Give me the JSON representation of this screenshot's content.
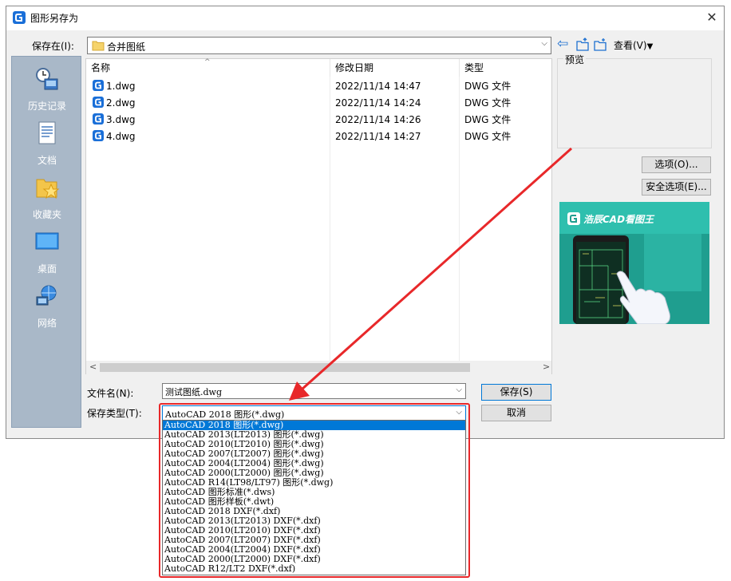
{
  "window": {
    "title": "图形另存为",
    "close_glyph": "✕"
  },
  "toolbar": {
    "save_in_label": "保存在(I):",
    "save_in_value": "合并图纸",
    "view_label": "查看(V)",
    "back_glyph": "⇦",
    "icons": [
      "back-icon",
      "up-folder-icon",
      "new-folder-icon"
    ]
  },
  "places": [
    {
      "label": "历史记录",
      "icon": "history-icon"
    },
    {
      "label": "文档",
      "icon": "documents-icon"
    },
    {
      "label": "收藏夹",
      "icon": "favorites-icon"
    },
    {
      "label": "桌面",
      "icon": "desktop-icon"
    },
    {
      "label": "网络",
      "icon": "network-icon"
    }
  ],
  "file_list": {
    "columns": [
      "名称",
      "修改日期",
      "类型"
    ],
    "rows": [
      {
        "name": "1.dwg",
        "date": "2022/11/14 14:47",
        "type": "DWG 文件"
      },
      {
        "name": "2.dwg",
        "date": "2022/11/14 14:24",
        "type": "DWG 文件"
      },
      {
        "name": "3.dwg",
        "date": "2022/11/14 14:26",
        "type": "DWG 文件"
      },
      {
        "name": "4.dwg",
        "date": "2022/11/14 14:27",
        "type": "DWG 文件"
      }
    ]
  },
  "preview": {
    "label": "预览"
  },
  "buttons": {
    "options": "选项(O)...",
    "security": "安全选项(E)...",
    "save": "保存(S)",
    "cancel": "取消"
  },
  "filename": {
    "label": "文件名(N):",
    "value": "测试图纸.dwg"
  },
  "filetype": {
    "label": "保存类型(T):",
    "value": "AutoCAD 2018 图形(*.dwg)",
    "options": [
      "AutoCAD 2018 图形(*.dwg)",
      "AutoCAD 2013(LT2013) 图形(*.dwg)",
      "AutoCAD 2010(LT2010) 图形(*.dwg)",
      "AutoCAD 2007(LT2007) 图形(*.dwg)",
      "AutoCAD 2004(LT2004) 图形(*.dwg)",
      "AutoCAD 2000(LT2000) 图形(*.dwg)",
      "AutoCAD R14(LT98/LT97) 图形(*.dwg)",
      "AutoCAD 图形标准(*.dws)",
      "AutoCAD 图形样板(*.dwt)",
      "AutoCAD 2018 DXF(*.dxf)",
      "AutoCAD 2013(LT2013) DXF(*.dxf)",
      "AutoCAD 2010(LT2010) DXF(*.dxf)",
      "AutoCAD 2007(LT2007) DXF(*.dxf)",
      "AutoCAD 2004(LT2004) DXF(*.dxf)",
      "AutoCAD 2000(LT2000) DXF(*.dxf)",
      "AutoCAD R12/LT2 DXF(*.dxf)"
    ],
    "selected_index": 0
  },
  "ad": {
    "brand": "浩辰CAD看图王"
  },
  "colors": {
    "accent": "#0078d7",
    "annotation_red": "#e8282a",
    "ad_bg": "#1f9e8f",
    "places_bg": "#a9b8c8"
  }
}
